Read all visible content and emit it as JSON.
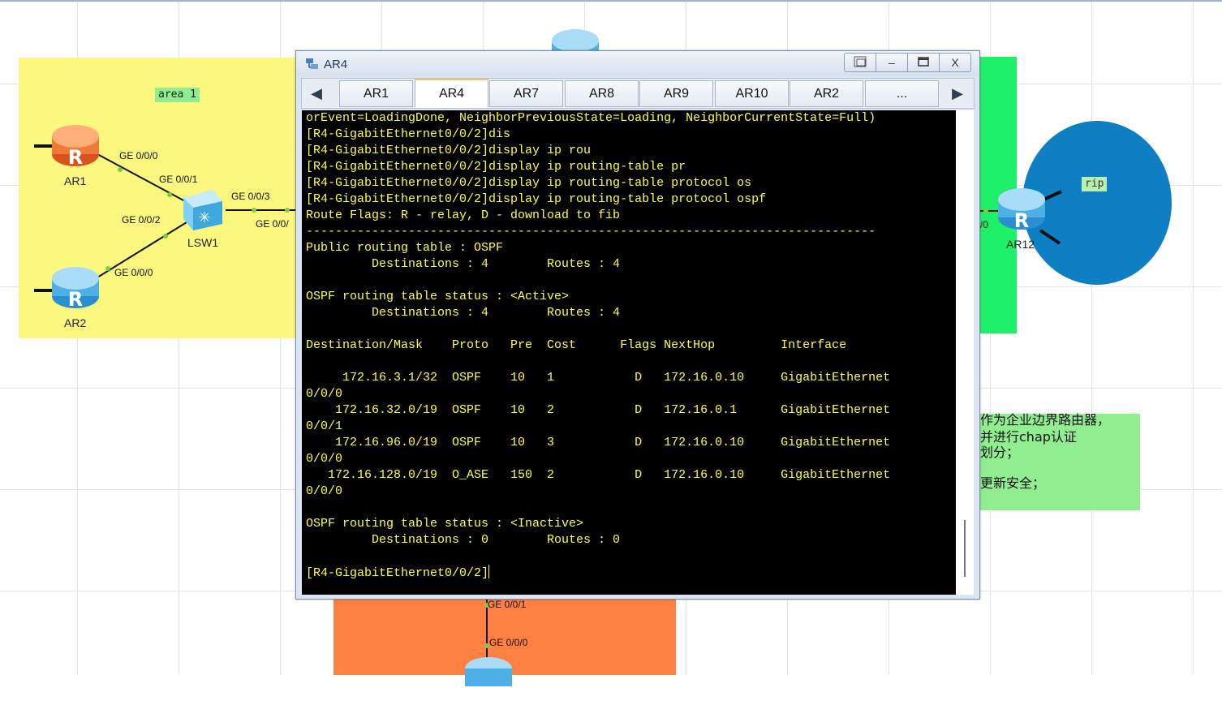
{
  "topology": {
    "area_label": "area 1",
    "rip_label": "rip",
    "devices": {
      "ar1": "AR1",
      "ar2": "AR2",
      "lsw1": "LSW1",
      "ar12": "AR12"
    },
    "ports": {
      "ar1_ge000": "GE 0/0/0",
      "lsw1_ge001": "GE 0/0/1",
      "lsw1_ge003": "GE 0/0/3",
      "lsw1_ge002": "GE 0/0/2",
      "ar2_ge000": "GE 0/0/0",
      "lsw1_ge00x": "GE 0/0/",
      "ar12_port": "/0",
      "bottom_ge001": "GE 0/0/1",
      "bottom_ge000": "GE 0/0/0"
    },
    "note_lines": [
      "作为企业边界路由器，",
      "并进行chap认证",
      "划分；",
      "",
      "更新安全；"
    ],
    "colors": {
      "area1": "#fcf77e",
      "green_area": "#1ff06a",
      "orange_area": "#ff8040",
      "rip_area": "#0f7fc3",
      "note": "#90ee90"
    }
  },
  "window": {
    "title": "AR4",
    "controls": {
      "restore": "restore-icon",
      "minimize": "–",
      "maximize": "maximize-icon",
      "close": "X"
    },
    "tabs": [
      "AR1",
      "AR4",
      "AR7",
      "AR8",
      "AR9",
      "AR10",
      "AR2",
      "..."
    ],
    "active_tab": "AR4",
    "terminal_lines": [
      "orEvent=LoadingDone, NeighborPreviousState=Loading, NeighborCurrentState=Full)",
      "[R4-GigabitEthernet0/0/2]dis",
      "[R4-GigabitEthernet0/0/2]display ip rou",
      "[R4-GigabitEthernet0/0/2]display ip routing-table pr",
      "[R4-GigabitEthernet0/0/2]display ip routing-table protocol os",
      "[R4-GigabitEthernet0/0/2]display ip routing-table protocol ospf",
      "Route Flags: R - relay, D - download to fib",
      "------------------------------------------------------------------------------",
      "Public routing table : OSPF",
      "         Destinations : 4        Routes : 4",
      "",
      "OSPF routing table status : <Active>",
      "         Destinations : 4        Routes : 4",
      "",
      "Destination/Mask    Proto   Pre  Cost      Flags NextHop         Interface",
      "",
      "     172.16.3.1/32  OSPF    10   1           D   172.16.0.10     GigabitEthernet",
      "0/0/0",
      "    172.16.32.0/19  OSPF    10   2           D   172.16.0.1      GigabitEthernet",
      "0/0/1",
      "    172.16.96.0/19  OSPF    10   3           D   172.16.0.10     GigabitEthernet",
      "0/0/0",
      "   172.16.128.0/19  O_ASE   150  2           D   172.16.0.10     GigabitEthernet",
      "0/0/0",
      "",
      "OSPF routing table status : <Inactive>",
      "         Destinations : 0        Routes : 0",
      "",
      "[R4-GigabitEthernet0/0/2]"
    ]
  }
}
